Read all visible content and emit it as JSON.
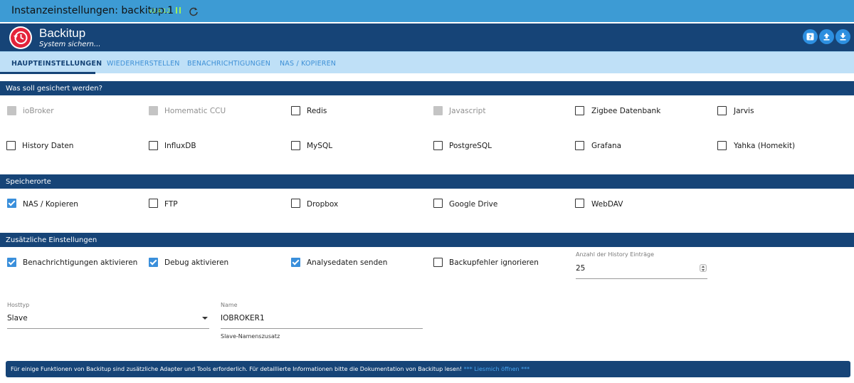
{
  "window": {
    "title": "Instanzeinstellungen: backitup.1",
    "version": "v2.4.12"
  },
  "header": {
    "app_name": "Backitup",
    "subtitle": "System sichern..."
  },
  "tabs": [
    "HAUPTEINSTELLUNGEN",
    "WIEDERHERSTELLEN",
    "BENACHRICHTIGUNGEN",
    "NAS / KOPIEREN"
  ],
  "sections": {
    "backup_what": "Was soll gesichert werden?",
    "storage": "Speicherorte",
    "additional": "Zusätzliche Einstellungen"
  },
  "backup_items": [
    {
      "label": "ioBroker",
      "state": "disabled"
    },
    {
      "label": "Homematic CCU",
      "state": "disabled"
    },
    {
      "label": "Redis",
      "state": "unchecked"
    },
    {
      "label": "Javascript",
      "state": "disabled"
    },
    {
      "label": "Zigbee Datenbank",
      "state": "unchecked"
    },
    {
      "label": "Jarvis",
      "state": "unchecked"
    },
    {
      "label": "History Daten",
      "state": "unchecked"
    },
    {
      "label": "InfluxDB",
      "state": "unchecked"
    },
    {
      "label": "MySQL",
      "state": "unchecked"
    },
    {
      "label": "PostgreSQL",
      "state": "unchecked"
    },
    {
      "label": "Grafana",
      "state": "unchecked"
    },
    {
      "label": "Yahka (Homekit)",
      "state": "unchecked"
    }
  ],
  "storage_items": [
    {
      "label": "NAS / Kopieren",
      "state": "checked"
    },
    {
      "label": "FTP",
      "state": "unchecked"
    },
    {
      "label": "Dropbox",
      "state": "unchecked"
    },
    {
      "label": "Google Drive",
      "state": "unchecked"
    },
    {
      "label": "WebDAV",
      "state": "unchecked"
    }
  ],
  "additional_items": [
    {
      "label": "Benachrichtigungen aktivieren",
      "state": "checked"
    },
    {
      "label": "Debug aktivieren",
      "state": "checked"
    },
    {
      "label": "Analysedaten senden",
      "state": "checked"
    },
    {
      "label": "Backupfehler ignorieren",
      "state": "unchecked"
    }
  ],
  "history_entries": {
    "label": "Anzahl der History Einträge",
    "value": "25"
  },
  "host_type": {
    "label": "Hosttyp",
    "value": "Slave"
  },
  "name_field": {
    "label": "Name",
    "value": "IOBROKER1",
    "helper": "Slave-Namenszusatz"
  },
  "info": {
    "text": "Für einige Funktionen von Backitup sind zusätzliche Adapter und Tools erforderlich. Für detaillierte Informationen bitte die Dokumentation von Backitup lesen!",
    "link": "*** Liesmich öffnen ***"
  },
  "colors": {
    "primary": "#164477",
    "accent": "#3a8fdb",
    "titlebar": "#3d9bd4",
    "tabs_bg": "#bfe0f7"
  }
}
